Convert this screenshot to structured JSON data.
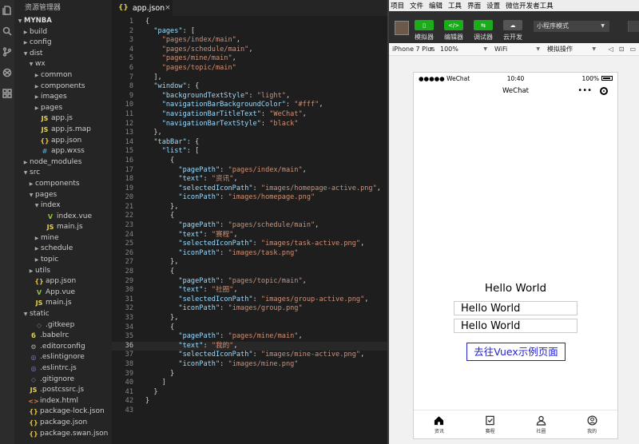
{
  "explorer": {
    "title": "资源管理器",
    "items": [
      {
        "label": "MYNBA",
        "depth": 0,
        "chevron": "▼",
        "icon": "",
        "iconColor": "",
        "root": true
      },
      {
        "label": "build",
        "depth": 1,
        "chevron": "▶",
        "icon": "",
        "iconColor": ""
      },
      {
        "label": "config",
        "depth": 1,
        "chevron": "▶",
        "icon": "",
        "iconColor": ""
      },
      {
        "label": "dist",
        "depth": 1,
        "chevron": "▼",
        "icon": "",
        "iconColor": ""
      },
      {
        "label": "wx",
        "depth": 2,
        "chevron": "▼",
        "icon": "",
        "iconColor": ""
      },
      {
        "label": "common",
        "depth": 3,
        "chevron": "▶",
        "icon": "",
        "iconColor": ""
      },
      {
        "label": "components",
        "depth": 3,
        "chevron": "▶",
        "icon": "",
        "iconColor": ""
      },
      {
        "label": "images",
        "depth": 3,
        "chevron": "▶",
        "icon": "",
        "iconColor": ""
      },
      {
        "label": "pages",
        "depth": 3,
        "chevron": "▶",
        "icon": "",
        "iconColor": ""
      },
      {
        "label": "app.js",
        "depth": 3,
        "chevron": "",
        "icon": "JS",
        "iconColor": "#e8d44d"
      },
      {
        "label": "app.js.map",
        "depth": 3,
        "chevron": "",
        "icon": "JS",
        "iconColor": "#e8d44d"
      },
      {
        "label": "app.json",
        "depth": 3,
        "chevron": "",
        "icon": "{}",
        "iconColor": "#e2c041"
      },
      {
        "label": "app.wxss",
        "depth": 3,
        "chevron": "",
        "icon": "#",
        "iconColor": "#519aba"
      },
      {
        "label": "node_modules",
        "depth": 1,
        "chevron": "▶",
        "icon": "",
        "iconColor": ""
      },
      {
        "label": "src",
        "depth": 1,
        "chevron": "▼",
        "icon": "",
        "iconColor": ""
      },
      {
        "label": "components",
        "depth": 2,
        "chevron": "▶",
        "icon": "",
        "iconColor": ""
      },
      {
        "label": "pages",
        "depth": 2,
        "chevron": "▼",
        "icon": "",
        "iconColor": ""
      },
      {
        "label": "index",
        "depth": 3,
        "chevron": "▼",
        "icon": "",
        "iconColor": ""
      },
      {
        "label": "index.vue",
        "depth": 4,
        "chevron": "",
        "icon": "V",
        "iconColor": "#8dc149"
      },
      {
        "label": "main.js",
        "depth": 4,
        "chevron": "",
        "icon": "JS",
        "iconColor": "#e8d44d"
      },
      {
        "label": "mine",
        "depth": 3,
        "chevron": "▶",
        "icon": "",
        "iconColor": ""
      },
      {
        "label": "schedule",
        "depth": 3,
        "chevron": "▶",
        "icon": "",
        "iconColor": ""
      },
      {
        "label": "topic",
        "depth": 3,
        "chevron": "▶",
        "icon": "",
        "iconColor": ""
      },
      {
        "label": "utils",
        "depth": 2,
        "chevron": "▶",
        "icon": "",
        "iconColor": ""
      },
      {
        "label": "app.json",
        "depth": 2,
        "chevron": "",
        "icon": "{}",
        "iconColor": "#e2c041"
      },
      {
        "label": "App.vue",
        "depth": 2,
        "chevron": "",
        "icon": "V",
        "iconColor": "#8dc149"
      },
      {
        "label": "main.js",
        "depth": 2,
        "chevron": "",
        "icon": "JS",
        "iconColor": "#e8d44d"
      },
      {
        "label": "static",
        "depth": 1,
        "chevron": "▼",
        "icon": "",
        "iconColor": ""
      },
      {
        "label": ".gitkeep",
        "depth": 2,
        "chevron": "",
        "icon": "◇",
        "iconColor": "#6d8086"
      },
      {
        "label": ".babelrc",
        "depth": 1,
        "chevron": "",
        "icon": "б",
        "iconColor": "#e8d44d"
      },
      {
        "label": ".editorconfig",
        "depth": 1,
        "chevron": "",
        "icon": "⚙",
        "iconColor": "#aaaaaa"
      },
      {
        "label": ".eslintignore",
        "depth": 1,
        "chevron": "",
        "icon": "◎",
        "iconColor": "#8080d0"
      },
      {
        "label": ".eslintrc.js",
        "depth": 1,
        "chevron": "",
        "icon": "◎",
        "iconColor": "#8080d0"
      },
      {
        "label": ".gitignore",
        "depth": 1,
        "chevron": "",
        "icon": "◇",
        "iconColor": "#6d8086"
      },
      {
        "label": ".postcssrc.js",
        "depth": 1,
        "chevron": "",
        "icon": "JS",
        "iconColor": "#e8d44d"
      },
      {
        "label": "index.html",
        "depth": 1,
        "chevron": "",
        "icon": "<>",
        "iconColor": "#e37933"
      },
      {
        "label": "package-lock.json",
        "depth": 1,
        "chevron": "",
        "icon": "{}",
        "iconColor": "#e2c041"
      },
      {
        "label": "package.json",
        "depth": 1,
        "chevron": "",
        "icon": "{}",
        "iconColor": "#e2c041"
      },
      {
        "label": "package.swan.json",
        "depth": 1,
        "chevron": "",
        "icon": "{}",
        "iconColor": "#e2c041"
      }
    ]
  },
  "editor": {
    "tab": {
      "icon": "{}",
      "label": "app.json",
      "close": "×"
    },
    "active_line": 36,
    "lines": [
      [
        [
          "p",
          "{"
        ]
      ],
      [
        [
          "p",
          "  "
        ],
        [
          "k",
          "\"pages\""
        ],
        [
          "p",
          ": ["
        ]
      ],
      [
        [
          "p",
          "    "
        ],
        [
          "s",
          "\"pages/index/main\""
        ],
        [
          "p",
          ","
        ]
      ],
      [
        [
          "p",
          "    "
        ],
        [
          "s",
          "\"pages/schedule/main\""
        ],
        [
          "p",
          ","
        ]
      ],
      [
        [
          "p",
          "    "
        ],
        [
          "s",
          "\"pages/mine/main\""
        ],
        [
          "p",
          ","
        ]
      ],
      [
        [
          "p",
          "    "
        ],
        [
          "s",
          "\"pages/topic/main\""
        ]
      ],
      [
        [
          "p",
          "  ],"
        ]
      ],
      [
        [
          "p",
          "  "
        ],
        [
          "k",
          "\"window\""
        ],
        [
          "p",
          ": {"
        ]
      ],
      [
        [
          "p",
          "    "
        ],
        [
          "k",
          "\"backgroundTextStyle\""
        ],
        [
          "p",
          ": "
        ],
        [
          "s",
          "\"light\""
        ],
        [
          "p",
          ","
        ]
      ],
      [
        [
          "p",
          "    "
        ],
        [
          "k",
          "\"navigationBarBackgroundColor\""
        ],
        [
          "p",
          ": "
        ],
        [
          "s",
          "\"#fff\""
        ],
        [
          "p",
          ","
        ]
      ],
      [
        [
          "p",
          "    "
        ],
        [
          "k",
          "\"navigationBarTitleText\""
        ],
        [
          "p",
          ": "
        ],
        [
          "s",
          "\"WeChat\""
        ],
        [
          "p",
          ","
        ]
      ],
      [
        [
          "p",
          "    "
        ],
        [
          "k",
          "\"navigationBarTextStyle\""
        ],
        [
          "p",
          ": "
        ],
        [
          "s",
          "\"black\""
        ]
      ],
      [
        [
          "p",
          "  },"
        ]
      ],
      [
        [
          "p",
          "  "
        ],
        [
          "k",
          "\"tabBar\""
        ],
        [
          "p",
          ": {"
        ]
      ],
      [
        [
          "p",
          "    "
        ],
        [
          "k",
          "\"list\""
        ],
        [
          "p",
          ": ["
        ]
      ],
      [
        [
          "p",
          "      {"
        ]
      ],
      [
        [
          "p",
          "        "
        ],
        [
          "k",
          "\"pagePath\""
        ],
        [
          "p",
          ": "
        ],
        [
          "s",
          "\"pages/index/main\""
        ],
        [
          "p",
          ","
        ]
      ],
      [
        [
          "p",
          "        "
        ],
        [
          "k",
          "\"text\""
        ],
        [
          "p",
          ": "
        ],
        [
          "s",
          "\"资讯\""
        ],
        [
          "p",
          ","
        ]
      ],
      [
        [
          "p",
          "        "
        ],
        [
          "k",
          "\"selectedIconPath\""
        ],
        [
          "p",
          ": "
        ],
        [
          "s",
          "\"images/homepage-active.png\""
        ],
        [
          "p",
          ","
        ]
      ],
      [
        [
          "p",
          "        "
        ],
        [
          "k",
          "\"iconPath\""
        ],
        [
          "p",
          ": "
        ],
        [
          "s",
          "\"images/homepage.png\""
        ]
      ],
      [
        [
          "p",
          "      },"
        ]
      ],
      [
        [
          "p",
          "      {"
        ]
      ],
      [
        [
          "p",
          "        "
        ],
        [
          "k",
          "\"pagePath\""
        ],
        [
          "p",
          ": "
        ],
        [
          "s",
          "\"pages/schedule/main\""
        ],
        [
          "p",
          ","
        ]
      ],
      [
        [
          "p",
          "        "
        ],
        [
          "k",
          "\"text\""
        ],
        [
          "p",
          ": "
        ],
        [
          "s",
          "\"赛程\""
        ],
        [
          "p",
          ","
        ]
      ],
      [
        [
          "p",
          "        "
        ],
        [
          "k",
          "\"selectedIconPath\""
        ],
        [
          "p",
          ": "
        ],
        [
          "s",
          "\"images/task-active.png\""
        ],
        [
          "p",
          ","
        ]
      ],
      [
        [
          "p",
          "        "
        ],
        [
          "k",
          "\"iconPath\""
        ],
        [
          "p",
          ": "
        ],
        [
          "s",
          "\"images/task.png\""
        ]
      ],
      [
        [
          "p",
          "      },"
        ]
      ],
      [
        [
          "p",
          "      {"
        ]
      ],
      [
        [
          "p",
          "        "
        ],
        [
          "k",
          "\"pagePath\""
        ],
        [
          "p",
          ": "
        ],
        [
          "s",
          "\"pages/topic/main\""
        ],
        [
          "p",
          ","
        ]
      ],
      [
        [
          "p",
          "        "
        ],
        [
          "k",
          "\"text\""
        ],
        [
          "p",
          ": "
        ],
        [
          "s",
          "\"社圈\""
        ],
        [
          "p",
          ","
        ]
      ],
      [
        [
          "p",
          "        "
        ],
        [
          "k",
          "\"selectedIconPath\""
        ],
        [
          "p",
          ": "
        ],
        [
          "s",
          "\"images/group-active.png\""
        ],
        [
          "p",
          ","
        ]
      ],
      [
        [
          "p",
          "        "
        ],
        [
          "k",
          "\"iconPath\""
        ],
        [
          "p",
          ": "
        ],
        [
          "s",
          "\"images/group.png\""
        ]
      ],
      [
        [
          "p",
          "      },"
        ]
      ],
      [
        [
          "p",
          "      {"
        ]
      ],
      [
        [
          "p",
          "        "
        ],
        [
          "k",
          "\"pagePath\""
        ],
        [
          "p",
          ": "
        ],
        [
          "s",
          "\"pages/mine/main\""
        ],
        [
          "p",
          ","
        ]
      ],
      [
        [
          "p",
          "        "
        ],
        [
          "k",
          "\"text\""
        ],
        [
          "p",
          ": "
        ],
        [
          "s",
          "\"我的\""
        ],
        [
          "p",
          ","
        ]
      ],
      [
        [
          "p",
          "        "
        ],
        [
          "k",
          "\"selectedIconPath\""
        ],
        [
          "p",
          ": "
        ],
        [
          "s",
          "\"images/mine-active.png\""
        ],
        [
          "p",
          ","
        ]
      ],
      [
        [
          "p",
          "        "
        ],
        [
          "k",
          "\"iconPath\""
        ],
        [
          "p",
          ": "
        ],
        [
          "s",
          "\"images/mine.png\""
        ]
      ],
      [
        [
          "p",
          "      }"
        ]
      ],
      [
        [
          "p",
          "    ]"
        ]
      ],
      [
        [
          "p",
          "  }"
        ]
      ],
      [
        [
          "p",
          "}"
        ]
      ],
      [
        [
          "p",
          ""
        ]
      ]
    ]
  },
  "devtools": {
    "menu": [
      "项目",
      "文件",
      "编辑",
      "工具",
      "界面",
      "设置",
      "微信开发者工具"
    ],
    "toolbar": {
      "simulator": "模拟器",
      "editor": "编辑器",
      "debugger": "调试器",
      "cloud": "云开发",
      "mode": "小程序模式"
    },
    "devbar": {
      "device": "iPhone 7 Plus",
      "zoom": "100%",
      "network": "WiFi",
      "operation": "模拟操作"
    },
    "phone": {
      "carrier": "●●●●● WeChat",
      "time": "10:40",
      "battery": "100%",
      "nav_title": "WeChat",
      "capsule_dots": "•••",
      "hello": "Hello World",
      "input1": "Hello World",
      "input2": "Hello World",
      "link": "去往Vuex示例页面",
      "tabs": [
        "资讯",
        "赛程",
        "社圈",
        "我的"
      ]
    },
    "colors": {
      "green": "#1aad19",
      "link": "#2222d0"
    }
  }
}
